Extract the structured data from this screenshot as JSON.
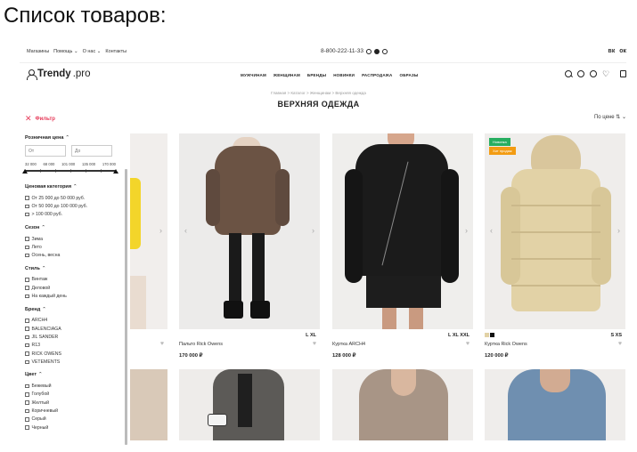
{
  "caption": "Список товаров:",
  "util": {
    "links": [
      "Магазины",
      "Помощь ⌄",
      "О нас ⌄",
      "Контакты"
    ],
    "phone": "8-800-222-11-33",
    "social": [
      "вк",
      "ок"
    ]
  },
  "header": {
    "logo_bold": "Trendy",
    "logo_suffix": ".pro",
    "nav": [
      "МУЖЧИНАМ",
      "ЖЕНЩИНАМ",
      "БРЕНДЫ",
      "НОВИНКИ",
      "РАСПРОДАЖА",
      "ОБРАЗЫ"
    ],
    "icons": [
      "search-icon",
      "clock-icon",
      "user-icon",
      "heart-icon",
      "bag-icon"
    ]
  },
  "breadcrumb": "Главная  >  Каталог  >  Женщинам  >  Верхняя одежда",
  "page_title": "ВЕРХНЯЯ ОДЕЖДА",
  "sort_label": "По цене ⇅ ⌄",
  "sidebar": {
    "filter_label": "Фильтр",
    "price": {
      "title": "Розничная цена",
      "from_placeholder": "От",
      "to_placeholder": "До",
      "ticks": [
        "32 000",
        "68 000",
        "101 000",
        "135 000",
        "170 000"
      ]
    },
    "price_category": {
      "title": "Ценовая категория",
      "options": [
        "От 25 000 до 50 000 руб.",
        "От 50 000 до 100 000 руб.",
        "> 100 000 руб."
      ]
    },
    "season": {
      "title": "Сезон",
      "options": [
        "Зима",
        "Лето",
        "Осень, весна"
      ]
    },
    "style": {
      "title": "Стиль",
      "options": [
        "Винтаж",
        "Деловой",
        "На каждый день"
      ]
    },
    "brand": {
      "title": "Бренд",
      "options": [
        "ARCH4",
        "BALENCIAGA",
        "JIL SANDER",
        "R13",
        "RICK OWENS",
        "VETEMENTS"
      ]
    },
    "color": {
      "title": "Цвет",
      "options": [
        "Бежевый",
        "Голубой",
        "Желтый",
        "Коричневый",
        "Серый",
        "Черный"
      ]
    }
  },
  "products": [
    {
      "name": "",
      "price": "",
      "sizes": "",
      "bg": "#f1eeec"
    },
    {
      "name": "Пальто Rick Owens",
      "price": "170 000 ₽",
      "sizes": "L  XL",
      "bg": "#ecebea"
    },
    {
      "name": "Куртка ARCH4",
      "price": "128 000 ₽",
      "sizes": "L  XL  XXL",
      "bg": "#efeeec"
    },
    {
      "name": "Куртка Rick Owens",
      "price": "120 000 ₽",
      "sizes": "S  XS",
      "bg": "#efedeb",
      "badges": [
        "Новинка",
        "Хит продаж"
      ],
      "swatches": [
        "#e2d2a6",
        "#111111"
      ]
    }
  ],
  "colors": {
    "accent": "#e63c5a",
    "badge_new": "#27ae60",
    "badge_hit": "#f39c12"
  }
}
